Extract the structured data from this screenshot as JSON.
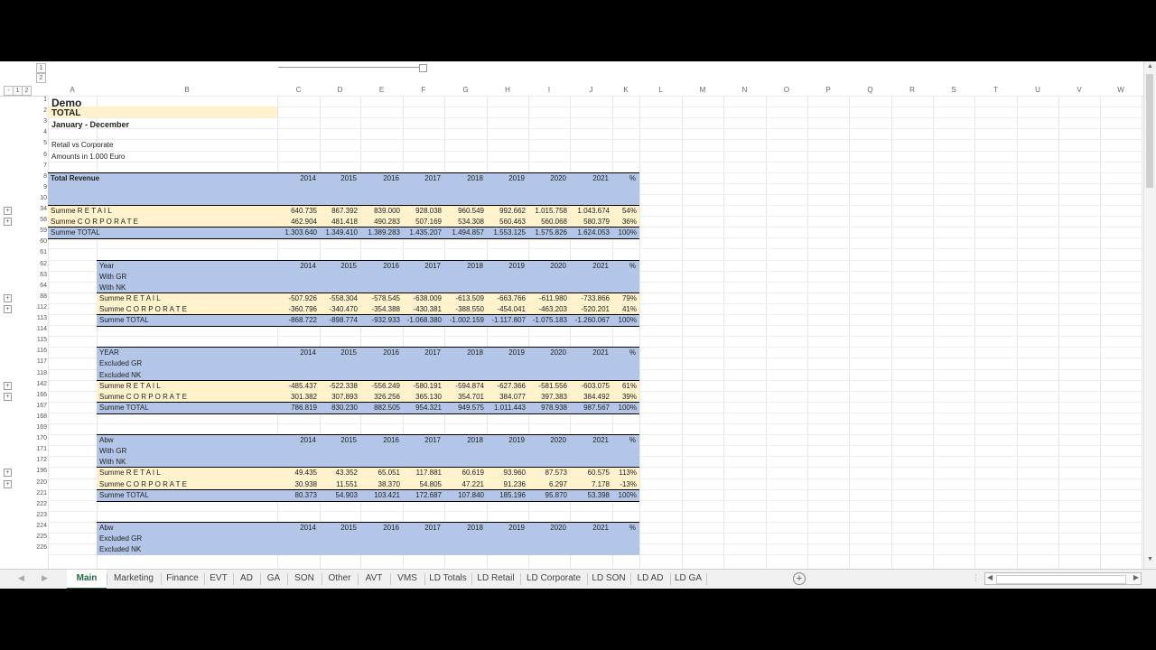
{
  "colors": {
    "blue_band": "#b4c6e7",
    "cream_band": "#fff2cc",
    "total_title_fill": "#fff2cc",
    "active_tab": "#1e6b3a"
  },
  "outline_levels": [
    "1",
    "2"
  ],
  "outline_corner": [
    "-",
    "1",
    "2",
    "3"
  ],
  "columns": [
    "A",
    "B",
    "C",
    "D",
    "E",
    "F",
    "G",
    "H",
    "I",
    "J",
    "K",
    "L",
    "M",
    "N",
    "O",
    "P",
    "Q",
    "R",
    "S",
    "T",
    "U",
    "V",
    "W"
  ],
  "header": {
    "title": "Demo",
    "subtitle": "TOTAL",
    "period": "January - December",
    "note1": "Retail vs Corporate",
    "note2": "Amounts in 1.000 Euro"
  },
  "years": [
    "2014",
    "2015",
    "2016",
    "2017",
    "2018",
    "2019",
    "2020",
    "2021",
    "%"
  ],
  "blocks": [
    {
      "label_rows": [
        {
          "n": "8",
          "t": "Total Revenue"
        },
        {
          "n": "9",
          "t": ""
        },
        {
          "n": "10",
          "t": ""
        }
      ],
      "rows": [
        {
          "n": "34",
          "t": "Summe  R E T A I L",
          "v": [
            "640.735",
            "867.392",
            "839.000",
            "928.038",
            "960.549",
            "992.662",
            "1.015.758",
            "1.043.674",
            "54%"
          ]
        },
        {
          "n": "58",
          "t": "Summe  C O R P O R A T E",
          "v": [
            "462.904",
            "481.418",
            "490.283",
            "507.169",
            "534.308",
            "560.463",
            "560.068",
            "580.379",
            "36%"
          ]
        },
        {
          "n": "59",
          "t": "Summe  TOTAL",
          "v": [
            "1.303.640",
            "1.349.410",
            "1.389.283",
            "1.435.207",
            "1.494.857",
            "1.553.125",
            "1.575.826",
            "1.624.053",
            "100%"
          ]
        }
      ]
    },
    {
      "label_rows": [
        {
          "n": "62",
          "t": "Year"
        },
        {
          "n": "63",
          "t": "With GR"
        },
        {
          "n": "64",
          "t": "With NK"
        }
      ],
      "rows": [
        {
          "n": "88",
          "t": "Summe  R E T A I L",
          "v": [
            "-507.926",
            "-558.304",
            "-578.545",
            "-638.009",
            "-613.509",
            "-663.766",
            "-611.980",
            "-733.866",
            "79%"
          ]
        },
        {
          "n": "112",
          "t": "Summe  C O R P O R A T E",
          "v": [
            "-360.796",
            "-340.470",
            "-354.388",
            "-430.381",
            "-388.550",
            "-454.041",
            "-463.203",
            "-520.201",
            "41%"
          ]
        },
        {
          "n": "113",
          "t": "Summe  TOTAL",
          "v": [
            "-868.722",
            "-898.774",
            "-932.933",
            "-1.068.380",
            "-1.002.159",
            "-1.117.807",
            "-1.075.183",
            "-1.260.067",
            "100%"
          ]
        }
      ]
    },
    {
      "label_rows": [
        {
          "n": "116",
          "t": "YEAR"
        },
        {
          "n": "117",
          "t": "Excluded GR"
        },
        {
          "n": "118",
          "t": "Excluded NK"
        }
      ],
      "rows": [
        {
          "n": "142",
          "t": "Summe  R E T A I L",
          "v": [
            "-485.437",
            "-522.338",
            "-556.249",
            "-580.191",
            "-594.874",
            "-627.366",
            "-581.556",
            "-603.075",
            "61%"
          ]
        },
        {
          "n": "166",
          "t": "Summe  C O R P O R A T E",
          "v": [
            "301.382",
            "307.893",
            "326.256",
            "365.130",
            "354.701",
            "384.077",
            "397.383",
            "384.492",
            "39%"
          ]
        },
        {
          "n": "167",
          "t": "Summe  TOTAL",
          "v": [
            "786.819",
            "830.230",
            "882.505",
            "954.321",
            "949.575",
            "1.011.443",
            "978.938",
            "987.567",
            "100%"
          ]
        }
      ]
    },
    {
      "label_rows": [
        {
          "n": "170",
          "t": "Abw"
        },
        {
          "n": "171",
          "t": "With GR"
        },
        {
          "n": "172",
          "t": "With NK"
        }
      ],
      "rows": [
        {
          "n": "196",
          "t": "Summe  R E T A I L",
          "v": [
            "49.435",
            "43.352",
            "65.051",
            "117.881",
            "60.619",
            "93.960",
            "87.573",
            "60.575",
            "113%"
          ]
        },
        {
          "n": "220",
          "t": "Summe  C O R P O R A T E",
          "v": [
            "30.938",
            "11.551",
            "38.370",
            "54.805",
            "47.221",
            "91.236",
            "6.297",
            "7.178",
            "-13%"
          ]
        },
        {
          "n": "221",
          "t": "Summe  TOTAL",
          "v": [
            "80.373",
            "54.903",
            "103.421",
            "172.687",
            "107.840",
            "185.196",
            "95.870",
            "53.398",
            "100%"
          ]
        }
      ]
    },
    {
      "label_rows": [
        {
          "n": "224",
          "t": "Abw"
        },
        {
          "n": "225",
          "t": "Excluded GR"
        },
        {
          "n": "226",
          "t": "Excluded NK"
        }
      ],
      "rows": []
    }
  ],
  "blank_rows": {
    "r4": "4",
    "r7": "7",
    "r60": "60",
    "r61": "61",
    "r114": "114",
    "r115": "115",
    "r168": "168",
    "r169": "169",
    "r222": "222",
    "r223": "223",
    "r1": "1",
    "r2": "2",
    "r3": "3",
    "r5": "5",
    "r6": "6"
  },
  "sheet_tabs": [
    "Main",
    "Marketing",
    "Finance",
    "EVT",
    "AD",
    "GA",
    "SON",
    "Other",
    "AVT",
    "VMS",
    "LD Totals",
    "LD Retail",
    "LD Corporate",
    "LD SON",
    "LD AD",
    "LD GA"
  ],
  "active_tab": "Main"
}
